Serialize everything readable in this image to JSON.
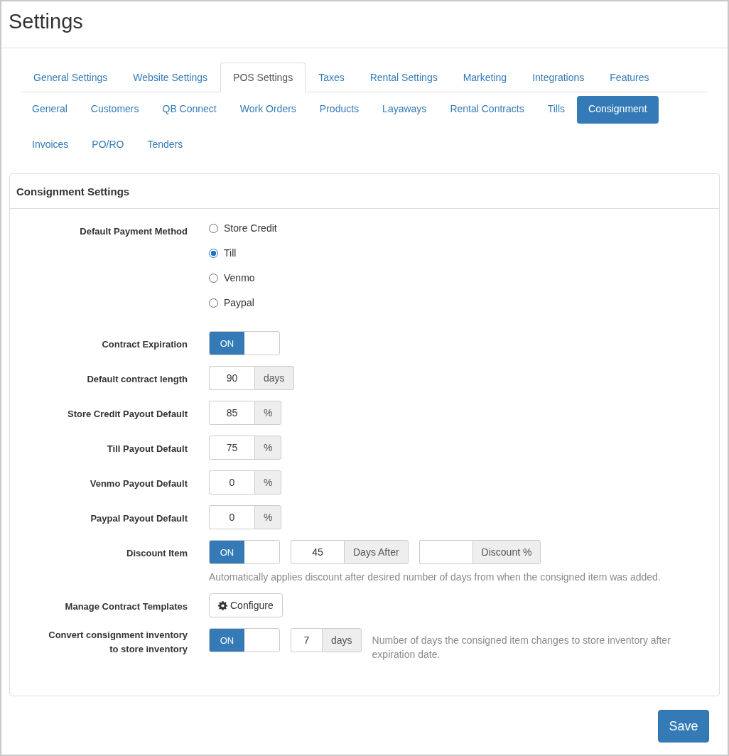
{
  "page_title": "Settings",
  "main_tabs": [
    {
      "label": "General Settings",
      "selected": false
    },
    {
      "label": "Website Settings",
      "selected": false
    },
    {
      "label": "POS Settings",
      "selected": true
    },
    {
      "label": "Taxes",
      "selected": false
    },
    {
      "label": "Rental Settings",
      "selected": false
    },
    {
      "label": "Marketing",
      "selected": false
    },
    {
      "label": "Integrations",
      "selected": false
    },
    {
      "label": "Features",
      "selected": false
    }
  ],
  "sub_tabs": [
    {
      "label": "General",
      "selected": false
    },
    {
      "label": "Customers",
      "selected": false
    },
    {
      "label": "QB Connect",
      "selected": false
    },
    {
      "label": "Work Orders",
      "selected": false
    },
    {
      "label": "Products",
      "selected": false
    },
    {
      "label": "Layaways",
      "selected": false
    },
    {
      "label": "Rental Contracts",
      "selected": false
    },
    {
      "label": "Tills",
      "selected": false
    },
    {
      "label": "Consignment",
      "selected": true
    },
    {
      "label": "Invoices",
      "selected": false
    },
    {
      "label": "PO/RO",
      "selected": false
    },
    {
      "label": "Tenders",
      "selected": false
    }
  ],
  "panel": {
    "title": "Consignment Settings",
    "rows": [
      {
        "kind": "radio",
        "label": "Default Payment Method",
        "options": [
          {
            "label": "Store Credit",
            "selected": false
          },
          {
            "label": "Till",
            "selected": true
          },
          {
            "label": "Venmo",
            "selected": false
          },
          {
            "label": "Paypal",
            "selected": false
          }
        ]
      },
      {
        "kind": "toggle",
        "label": "Contract Expiration",
        "toggle": {
          "on": true,
          "text": "ON"
        }
      },
      {
        "kind": "fields",
        "label": "Default contract length",
        "fields": [
          {
            "value": "90",
            "addon": "days"
          }
        ]
      },
      {
        "kind": "fields",
        "label": "Store Credit Payout Default",
        "fields": [
          {
            "value": "85",
            "addon": "%"
          }
        ]
      },
      {
        "kind": "fields",
        "label": "Till Payout Default",
        "fields": [
          {
            "value": "75",
            "addon": "%"
          }
        ]
      },
      {
        "kind": "fields",
        "label": "Venmo Payout Default",
        "fields": [
          {
            "value": "0",
            "addon": "%"
          }
        ]
      },
      {
        "kind": "fields",
        "label": "Paypal Payout Default",
        "fields": [
          {
            "value": "0",
            "addon": "%"
          }
        ]
      },
      {
        "kind": "toggle",
        "label": "Discount Item",
        "toggle": {
          "on": true,
          "text": "ON"
        },
        "fields": [
          {
            "value": "45",
            "addon": "Days After"
          },
          {
            "addon": "Discount %"
          }
        ],
        "help": "Automatically applies discount after desired number of days from when the consigned item was added."
      },
      {
        "kind": "button",
        "label": "Manage Contract Templates",
        "button": "Configure"
      },
      {
        "kind": "inline",
        "label": "Convert consignment inventory to store inventory",
        "toggle": {
          "on": true,
          "text": "ON"
        },
        "fields": [
          {
            "value": "7",
            "addon": "days"
          }
        ],
        "help": "Number of days the consigned item changes to store inventory after expiration date."
      }
    ]
  },
  "save_button": "Save"
}
